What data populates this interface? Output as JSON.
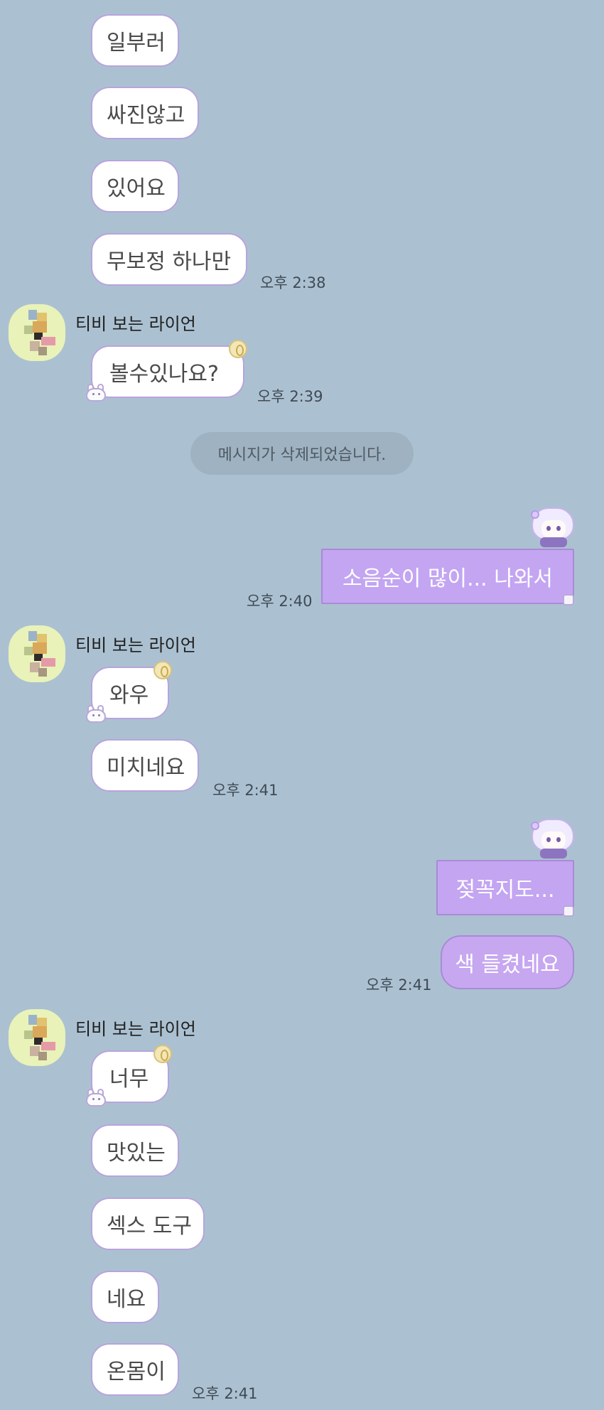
{
  "chat": {
    "sender_name": "티비 보는 라이언",
    "group1": {
      "messages": [
        "일부러",
        "싸진않고",
        "있어요",
        "무보정 하나만"
      ],
      "time": "오후 2:38"
    },
    "group2": {
      "messages": [
        "볼수있나요?"
      ],
      "time": "오후 2:39"
    },
    "system_notice": "메시지가 삭제되었습니다.",
    "mine1": {
      "messages": [
        "소음순이 많이... 나와서"
      ],
      "time": "오후 2:40"
    },
    "group3": {
      "messages": [
        "와우",
        "미치네요"
      ],
      "time": "오후 2:41"
    },
    "mine2": {
      "messages": [
        "젖꼭지도...",
        "색 들켰네요"
      ],
      "time": "오후 2:41"
    },
    "group4": {
      "messages": [
        "너무",
        "맛있는",
        "섹스 도구",
        "네요",
        "온몸이"
      ],
      "time": "오후 2:41"
    }
  },
  "colors": {
    "background": "#abc1d1",
    "incoming_bubble": "#ffffff",
    "outgoing_bubble": "#c6a7f0",
    "bubble_border": "#b9a3dd"
  },
  "icons": [
    "profile-avatar-icon",
    "bubble-badge-icon",
    "pet-sticker-icon",
    "chibi-sticker-icon"
  ]
}
